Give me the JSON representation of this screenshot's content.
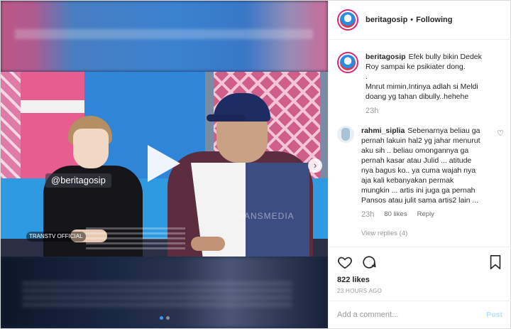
{
  "header": {
    "username": "beritagosip",
    "separator": "•",
    "follow_status": "Following"
  },
  "media": {
    "overlay_handle": "@beritagosip",
    "channel_badge": "TRANSTV OFFICIAL",
    "watermark": "TRANSMEDIA",
    "next_icon": "chevron-right-icon",
    "play_icon": "play-icon",
    "carousel_count": 2,
    "carousel_active": 1
  },
  "caption": {
    "username": "beritagosip",
    "line1": "Efek bully bikin Dedek Roy sampai ke psikiater dong.",
    "line2": ".",
    "line3": "Mnrut mimin,Intinya adlah si Meldi doang yg tahan dibully..hehehe",
    "time": "23h"
  },
  "comment": {
    "username": "rahmi_siplia",
    "text": "Sebenarnya beliau ga pernah lakuin hal2 yg jahar menurut aku sih .. beliau omongannya ga pernah kasar atau Julid ... atitude nya bagus ko.. ya cuma wajah nya aja kali kebanyakan permak mungkin ... artis ini juga ga pernah Pansos atau julit sama artis2 lain ...",
    "time": "23h",
    "likes": "80 likes",
    "reply": "Reply",
    "view_replies": "View replies (4)"
  },
  "actions": {
    "like_icon": "heart-icon",
    "comment_icon": "comment-bubble-icon",
    "save_icon": "bookmark-icon",
    "likes": "822 likes",
    "posted": "23 HOURS AGO"
  },
  "add_comment": {
    "placeholder": "Add a comment...",
    "post_label": "Post"
  },
  "colors": {
    "accent": "#3897f0",
    "post_disabled": "#b2dffc",
    "avatar_ring": "#d62976"
  }
}
